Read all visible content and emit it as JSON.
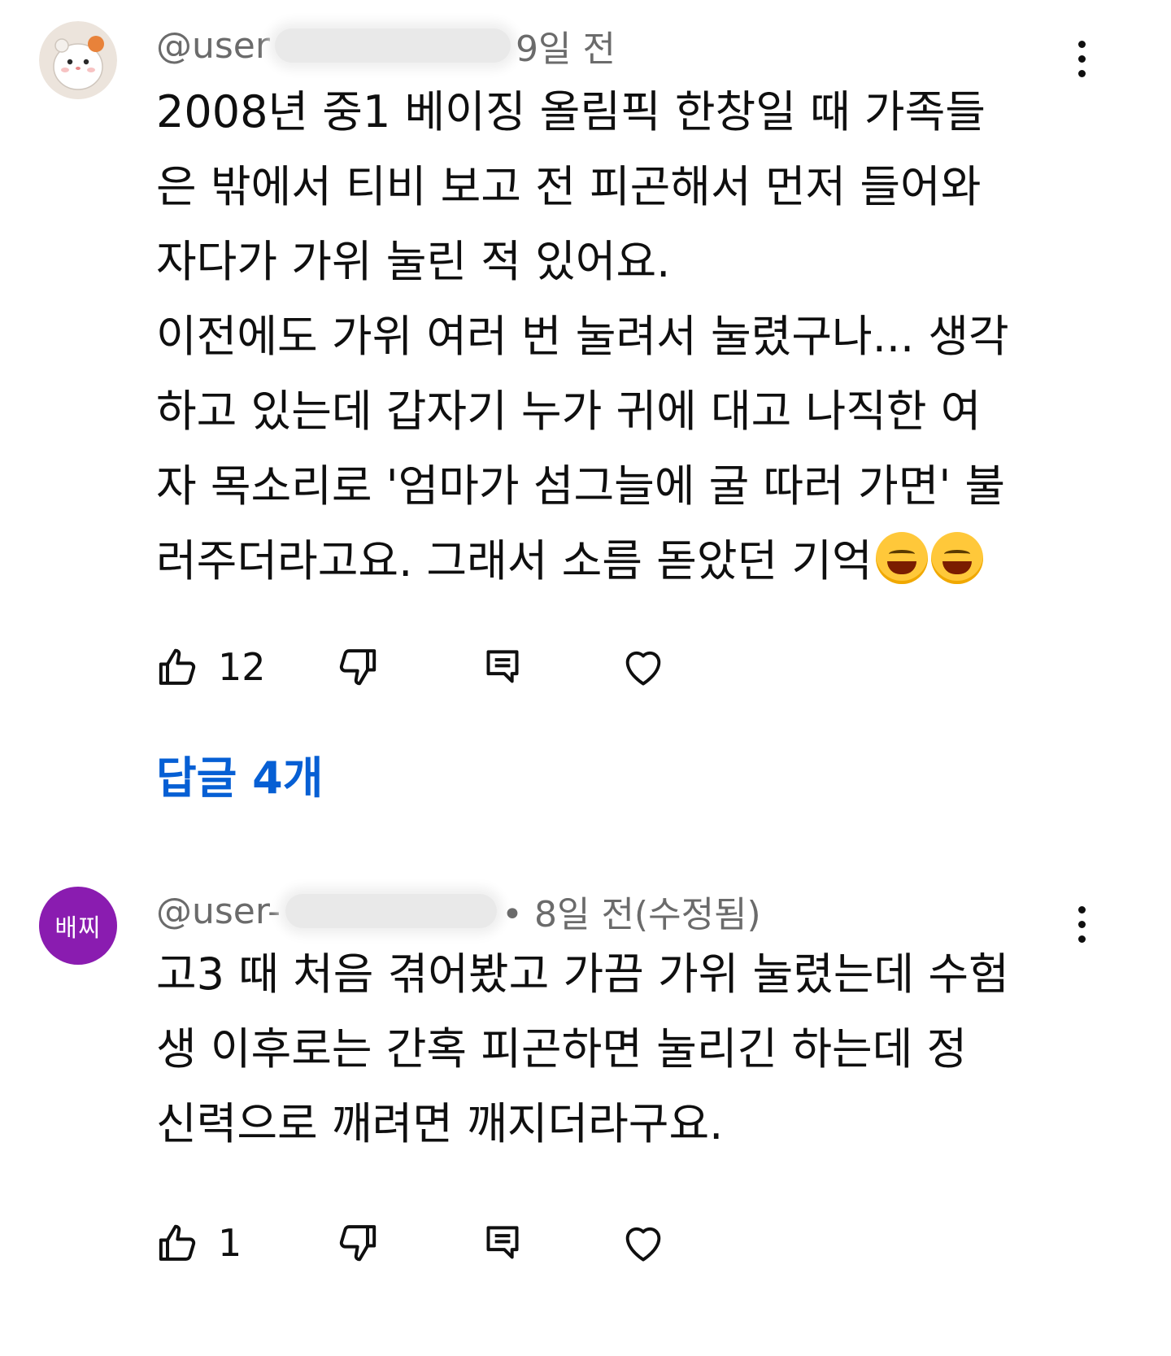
{
  "comments": [
    {
      "handle": "@user",
      "handle_suffix": "9일 전",
      "avatar": "hamster-avatar",
      "lines": [
        "2008년 중1 베이징 올림픽 한창일 때 가족들",
        "은 밖에서 티비 보고 전 피곤해서 먼저 들어와",
        "자다가 가위 눌린 적 있어요.",
        "이전에도 가위 여러 번 눌려서 눌렸구나... 생각",
        "하고 있는데 갑자기 누가 귀에 대고 나직한 여",
        "자 목소리로 '엄마가 섬그늘에 굴 따러 가면' 불",
        "러주더라고요. 그래서 소름 돋았던 기억"
      ],
      "emoji": "😂😂",
      "like_count": "12",
      "replies_label": "답글 4개"
    },
    {
      "handle": "@user-",
      "handle_suffix": "• 8일 전(수정됨)",
      "avatar_text": "배찌",
      "lines": [
        "고3 때 처음 겪어봤고 가끔 가위 눌렸는데 수험",
        "생 이후로는  간혹 피곤하면 눌리긴 하는데 정",
        "신력으로 깨려면 깨지더라구요."
      ],
      "like_count": "1"
    }
  ],
  "icons": {
    "like": "thumbs-up-icon",
    "dislike": "thumbs-down-icon",
    "reply": "reply-comment-icon",
    "heart": "heart-icon",
    "more": "more-vertical-icon"
  },
  "colors": {
    "text": "#0f0f0f",
    "meta": "#6b6b6b",
    "link": "#065fd4",
    "avatar_purple": "#8a1cb0"
  }
}
